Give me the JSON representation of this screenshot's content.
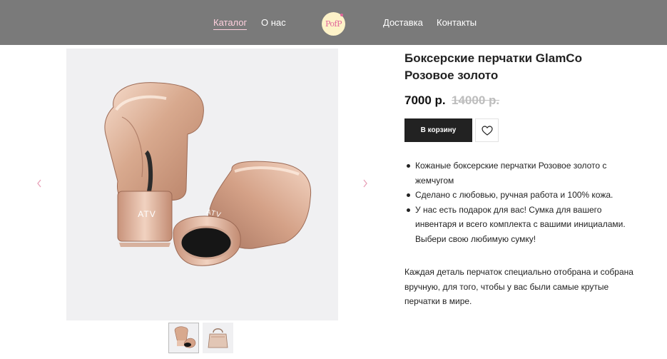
{
  "header": {
    "nav_left": [
      "Каталог",
      "О нас"
    ],
    "logo_text": "PofP",
    "nav_right": [
      "Доставка",
      "Контакты"
    ],
    "background_color": "#7a7a7a",
    "active_color": "#ffd0de"
  },
  "gallery": {
    "glove_brand": "ATV",
    "prev_icon": "chevron-left-icon",
    "next_icon": "chevron-right-icon",
    "arrow_color": "#e8a1b8",
    "thumbnails": [
      "gloves-thumbnail",
      "bag-thumbnail"
    ],
    "active_thumbnail": 0
  },
  "product": {
    "title": "Боксерские перчатки GlamCo Розовое золото",
    "price": "7000 р.",
    "old_price": "14000 р.",
    "cart_label": "В корзину",
    "favorite_icon": "heart-icon",
    "bullets": [
      "Кожаные боксерские перчатки Розовое золото с жемчугом",
      "Сделано с любовью, ручная работа и 100% кожа.",
      "У нас есть подарок для вас! Сумка для вашего инвентаря и всего комплекта с вашими инициалами. Выбери свою любимую сумку!"
    ],
    "description": "Каждая деталь перчаток специально отобрана и собрана вручную, для того, чтобы у вас были самые крутые перчатки в мире."
  }
}
